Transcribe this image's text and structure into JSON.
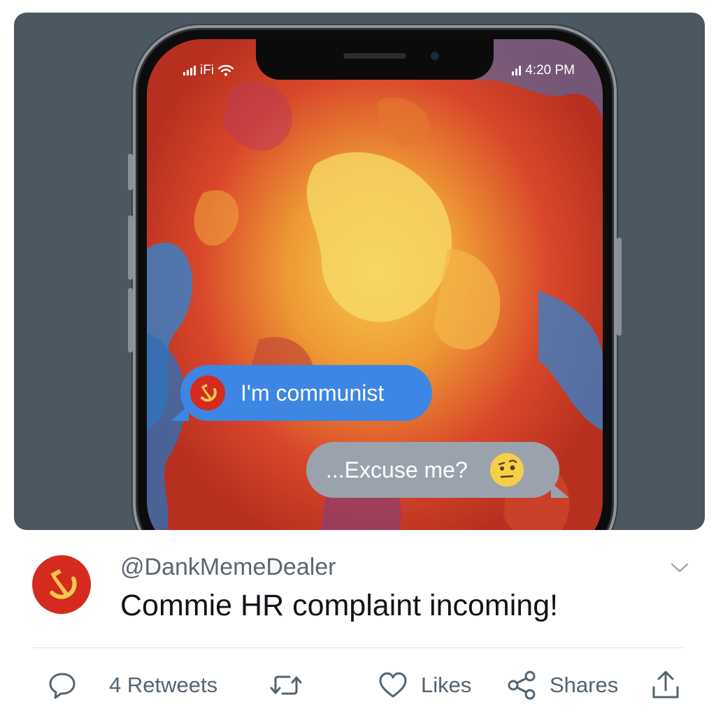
{
  "status_bar": {
    "left_text": "iFi",
    "right_text": "4:20 PM"
  },
  "chat": {
    "message_1": "I'm communist",
    "message_2": "...Excuse me?",
    "message_1_icon": "hammer-sickle-icon",
    "message_2_icon": "raised-eyebrow-emoji-icon"
  },
  "tweet": {
    "handle": "@DankMemeDealer",
    "text": "Commie HR complaint incoming!",
    "avatar_icon": "hammer-sickle-icon"
  },
  "actions": {
    "reply_icon": "reply-icon",
    "retweets_label": "4 Retweets",
    "retweet_icon": "retweet-icon",
    "likes_label": "Likes",
    "like_icon": "heart-icon",
    "shares_label": "Shares",
    "share_icon": "share-nodes-icon",
    "upload_icon": "upload-icon"
  },
  "colors": {
    "card_bg": "#4b5761",
    "bubble_blue": "#3d86e3",
    "bubble_gray": "#9aa3ad",
    "avatar_red": "#d52b1e",
    "text_secondary": "#536471"
  }
}
